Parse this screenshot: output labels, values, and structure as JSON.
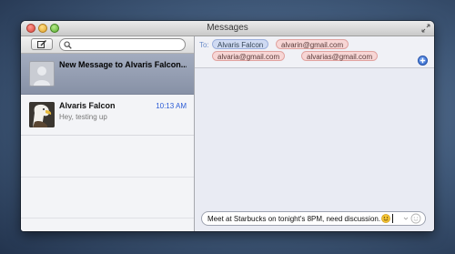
{
  "window": {
    "title": "Messages"
  },
  "sidebar": {
    "search": {
      "placeholder": ""
    },
    "conversations": [
      {
        "name": "New Message to Alvaris Falcon...",
        "time": "",
        "preview": "",
        "selected": true,
        "avatar": "blank-avatar"
      },
      {
        "name": "Alvaris Falcon",
        "time": "10:13 AM",
        "preview": "Hey, testing up",
        "selected": false,
        "avatar": "eagle-avatar"
      }
    ]
  },
  "compose": {
    "to_label": "To:",
    "recipients": [
      {
        "label": "Alvaris Falcon",
        "style": "blue"
      },
      {
        "label": "alvarin@gmail.com",
        "style": "red"
      },
      {
        "label": "alvaria@gmail.com",
        "style": "red"
      },
      {
        "label": "alvarias@gmail.com",
        "style": "red"
      }
    ],
    "message_text": "Meet at Starbucks on tonight's 8PM, need discussion."
  },
  "colors": {
    "selected_row": "#9099ad",
    "accent_blue": "#2d5dd6",
    "chip_blue": "#cfdaf2",
    "chip_red": "#f7d6d5"
  },
  "icons": [
    "compose-icon",
    "search-icon",
    "add-recipient-icon",
    "smiley-icon",
    "emoji-picker-icon",
    "fullscreen-icon"
  ]
}
